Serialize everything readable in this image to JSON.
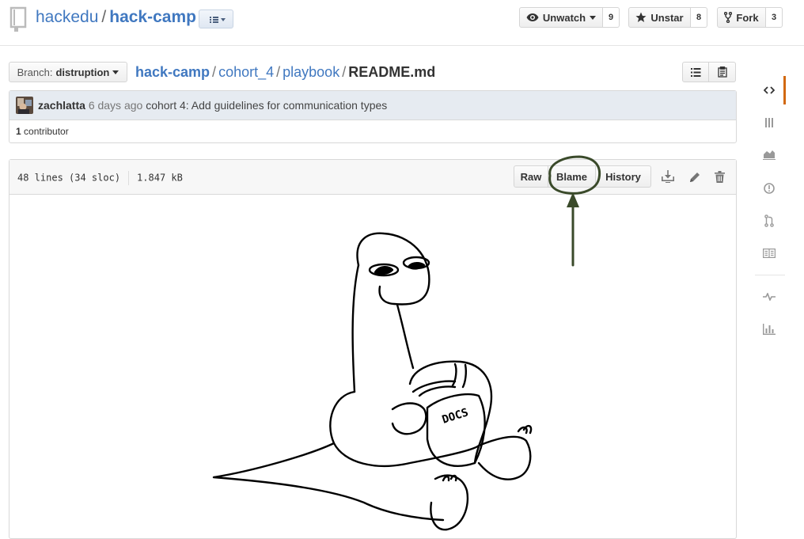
{
  "repo": {
    "owner": "hackedu",
    "separator": "/",
    "name": "hack-camp"
  },
  "header_actions": {
    "watch": {
      "label": "Unwatch",
      "count": "9"
    },
    "star": {
      "label": "Unstar",
      "count": "8"
    },
    "fork": {
      "label": "Fork",
      "count": "3"
    }
  },
  "branch": {
    "label": "Branch:",
    "value": "distruption"
  },
  "breadcrumb": {
    "repo": "hack-camp",
    "folder1": "cohort_4",
    "folder2": "playbook",
    "file": "README.md",
    "separator": "/"
  },
  "commit": {
    "author": "zachlatta",
    "time": "6 days ago",
    "message": "cohort 4: Add guidelines for communication types"
  },
  "contributors": {
    "count": "1",
    "label": "contributor"
  },
  "file": {
    "lines": "48 lines (34 sloc)",
    "size": "1.847 kB",
    "buttons": {
      "raw": "Raw",
      "blame": "Blame",
      "history": "History"
    }
  },
  "sidebar_icons": [
    "code-icon",
    "project-icon",
    "graph-icon",
    "issue-icon",
    "pull-request-icon",
    "wiki-icon",
    "pulse-icon",
    "stats-icon"
  ],
  "drawing_text": "DOCS",
  "colors": {
    "link": "#4078c0",
    "annotation": "#3a4a2a",
    "active_tab": "#d26911"
  }
}
